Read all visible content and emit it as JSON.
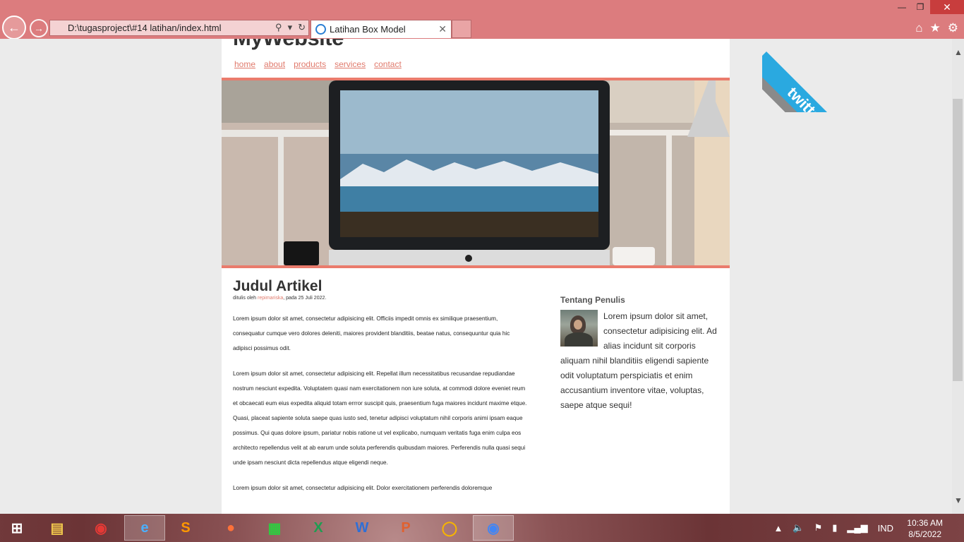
{
  "browser": {
    "address": "D:\\tugasproject\\#14 latihan/index.html",
    "tab_title": "Latihan Box Model",
    "colors": {
      "chrome": "#dc7c7e",
      "accent": "#ea7b6c"
    }
  },
  "site": {
    "title": "MyWebsite",
    "menu": [
      "home",
      "about",
      "products",
      "services",
      "contact"
    ],
    "ribbon": "twitter"
  },
  "article": {
    "title": "Judul Artikel",
    "meta_prefix": "ditulis oleh ",
    "author": "repimariska",
    "meta_suffix": ", pada 25 Juli 2022.",
    "paragraphs": [
      "Lorem ipsum dolor sit amet, consectetur adipisicing elit. Officiis impedit omnis ex similique praesentium, consequatur cumque vero dolores deleniti, maiores provident blanditiis, beatae natus, consequuntur quia hic adipisci possimus odit.",
      "Lorem ipsum dolor sit amet, consectetur adipisicing elit. Repellat illum necessitatibus recusandae repudiandae nostrum nesciunt expedita. Voluptatem quasi nam exercitationem non iure soluta, at commodi dolore eveniet reum et obcaecati eum eius expedita aliquid totam errror suscipit quis, praesentium fuga maiores incidunt maxime etque. Quasi, placeat sapiente soluta saepe quas iusto sed, tenetur adipisci voluptatum nihil corporis animi ipsam eaque possimus. Qui quas dolore ipsum, pariatur nobis ratione ut vel explicabo, numquam veritatis fuga enim culpa eos architecto repellendus velit at ab earum unde soluta perferendis quibusdam maiores. Perferendis nulla quasi sequi unde ipsam nesciunt dicta repellendus atque eligendi neque.",
      "Lorem ipsum dolor sit amet, consectetur adipisicing elit. Dolor exercitationem perferendis doloremque"
    ]
  },
  "aside": {
    "heading": "Tentang Penulis",
    "bio": "Lorem ipsum dolor sit amet, consectetur adipisicing elit. Ad alias incidunt sit corporis aliquam nihil blanditiis eligendi sapiente odit voluptatum perspiciatis et enim accusantium inventore vitae, voluptas, saepe atque sequi!"
  },
  "taskbar": {
    "apps": [
      "file-explorer",
      "screen-recorder",
      "internet-explorer",
      "sublime-text",
      "firefox",
      "store",
      "excel",
      "word",
      "powerpoint",
      "xampp",
      "chrome"
    ],
    "language": "IND",
    "time": "10:36 AM",
    "date": "8/5/2022"
  }
}
